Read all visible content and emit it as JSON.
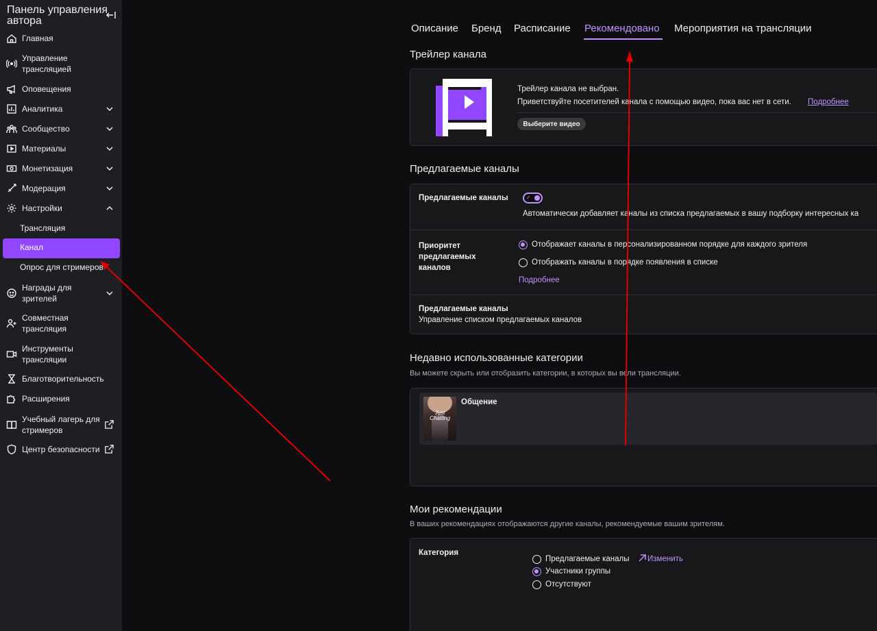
{
  "sidebar": {
    "title": "Панель управления автора",
    "items": [
      {
        "label": "Главная",
        "icon": "home-icon"
      },
      {
        "label": "Управление трансляцией",
        "icon": "broadcast-icon"
      },
      {
        "label": "Оповещения",
        "icon": "megaphone-icon"
      },
      {
        "label": "Аналитика",
        "icon": "analytics-icon"
      },
      {
        "label": "Сообщество",
        "icon": "community-icon"
      },
      {
        "label": "Материалы",
        "icon": "content-icon"
      },
      {
        "label": "Монетизация",
        "icon": "monetization-icon"
      },
      {
        "label": "Модерация",
        "icon": "sword-icon"
      },
      {
        "label": "Настройки",
        "icon": "gear-icon"
      },
      {
        "label": "Награды для зрителей",
        "icon": "rewards-icon"
      },
      {
        "label": "Совместная трансляция",
        "icon": "add-user-icon"
      },
      {
        "label": "Инструменты трансляции",
        "icon": "camera-icon"
      },
      {
        "label": "Благотворительность",
        "icon": "charity-icon"
      },
      {
        "label": "Расширения",
        "icon": "puzzle-icon"
      },
      {
        "label": "Учебный лагерь для стримеров",
        "icon": "book-icon"
      },
      {
        "label": "Центр безопасности",
        "icon": "shield-icon"
      }
    ],
    "settings_sub": {
      "stream": "Трансляция",
      "channel": "Канал",
      "survey": "Опрос для стримеров"
    }
  },
  "tabs": [
    "Описание",
    "Бренд",
    "Расписание",
    "Рекомендовано",
    "Мероприятия на трансляции"
  ],
  "active_tab": "Рекомендовано",
  "trailer": {
    "heading": "Трейлер канала",
    "line1": "Трейлер канала не выбран.",
    "line2": "Приветствуйте посетителей канала с помощью видео, пока вас нет в сети.",
    "more": "Подробнее",
    "button": "Выберите видео"
  },
  "suggested": {
    "heading": "Предлагаемые каналы",
    "toggle_label": "Предлагаемые каналы",
    "toggle_desc": "Автоматически добавляет каналы из списка предлагаемых в вашу подборку интересных ка",
    "priority_label": "Приоритет предлагаемых каналов",
    "option1": "Отображает каналы в персонализированном порядке для каждого зрителя",
    "option2": "Отображать каналы в порядке появления в списке",
    "more": "Подробнее",
    "manage_title": "Предлагаемые каналы",
    "manage_desc": "Управление списком предлагаемых каналов"
  },
  "recent": {
    "heading": "Недавно использованные категории",
    "desc": "Вы можете скрыть или отобразить категории, в которых вы вели трансляции.",
    "category": "Общение",
    "thumb_text": "Just Chatting"
  },
  "my_recs": {
    "heading": "Мои рекомендации",
    "desc": "В ваших рекомендациях отображаются другие каналы, рекомендуемые вашим зрителям.",
    "category_label": "Категория",
    "option1": "Предлагаемые каналы",
    "change": "Изменить",
    "option2": "Участники группы",
    "option3": "Отсутствуют"
  },
  "colors": {
    "accent": "#9147ff",
    "accent_light": "#bf94ff",
    "annotation": "#e00000"
  }
}
